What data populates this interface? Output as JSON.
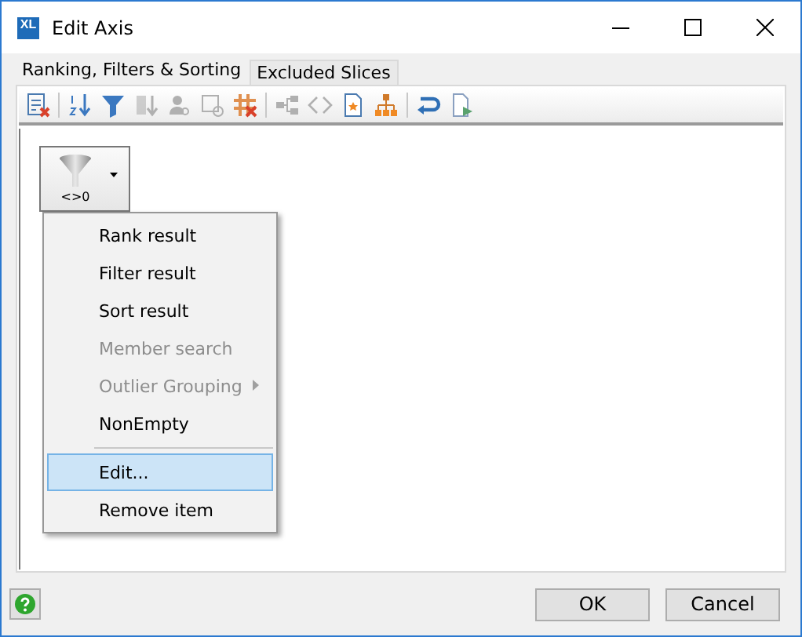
{
  "window": {
    "logo": "XL",
    "title": "Edit Axis"
  },
  "tabs": [
    {
      "label": "Ranking, Filters & Sorting",
      "selected": true
    },
    {
      "label": "Excluded Slices",
      "selected": false
    }
  ],
  "toolbar": [
    {
      "kind": "button",
      "disabled": false
    },
    {
      "kind": "separator"
    },
    {
      "kind": "button",
      "disabled": false
    },
    {
      "kind": "button",
      "disabled": false
    },
    {
      "kind": "button",
      "disabled": true
    },
    {
      "kind": "button",
      "disabled": true
    },
    {
      "kind": "button",
      "disabled": true
    },
    {
      "kind": "button",
      "disabled": false
    },
    {
      "kind": "separator"
    },
    {
      "kind": "button",
      "disabled": true
    },
    {
      "kind": "button",
      "disabled": true
    },
    {
      "kind": "button",
      "disabled": false
    },
    {
      "kind": "button",
      "disabled": false
    },
    {
      "kind": "separator"
    },
    {
      "kind": "button",
      "disabled": false
    },
    {
      "kind": "button",
      "disabled": false
    }
  ],
  "item_button": {
    "caption": "<>0"
  },
  "menu": [
    {
      "kind": "item",
      "label": "Rank result",
      "disabled": false,
      "selected": false
    },
    {
      "kind": "item",
      "label": "Filter result",
      "disabled": false,
      "selected": false
    },
    {
      "kind": "item",
      "label": "Sort result",
      "disabled": false,
      "selected": false
    },
    {
      "kind": "item",
      "label": "Member search",
      "disabled": true,
      "selected": false
    },
    {
      "kind": "submenu",
      "label": "Outlier Grouping",
      "disabled": true,
      "selected": false
    },
    {
      "kind": "item",
      "label": "NonEmpty",
      "disabled": false,
      "selected": false
    },
    {
      "kind": "separator"
    },
    {
      "kind": "item",
      "label": "Edit...",
      "disabled": false,
      "selected": true
    },
    {
      "kind": "item",
      "label": "Remove item",
      "disabled": false,
      "selected": false
    }
  ],
  "buttons": [
    {
      "label": "OK"
    },
    {
      "label": "Cancel"
    }
  ]
}
